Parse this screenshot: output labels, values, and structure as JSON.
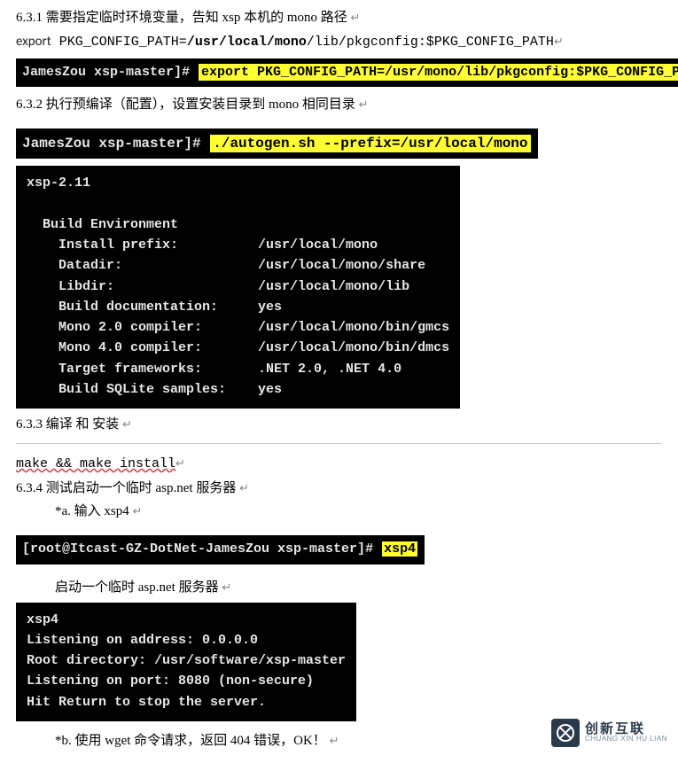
{
  "s1": {
    "num": "6.3.1",
    "text": "需要指定临时环境变量，告知 xsp  本机的  mono 路径",
    "ret": "↵"
  },
  "exportline": {
    "kw": "export",
    "pre": " PKG_CONFIG_PATH=",
    "bold": "/usr/local/mono",
    "post": "/lib/pkgconfig:$PKG_CONFIG_PATH",
    "ret": "↵"
  },
  "cmd1": {
    "prompt": "JamesZou xsp-master]# ",
    "hl": "export PKG_CONFIG_PATH=/usr/mono/lib/pkgconfig:$PKG_CONFIG_PATH"
  },
  "s2": {
    "num": "6.3.2",
    "text": "执行预编译（配置），设置安装目录到  mono 相同目录",
    "ret": "↵"
  },
  "cmd2": {
    "prompt": " JamesZou xsp-master]# ",
    "hl": "./autogen.sh --prefix=/usr/local/mono"
  },
  "buildenv": "xsp-2.11\n\n  Build Environment\n    Install prefix:          /usr/local/mono\n    Datadir:                 /usr/local/mono/share\n    Libdir:                  /usr/local/mono/lib\n    Build documentation:     yes\n    Mono 2.0 compiler:       /usr/local/mono/bin/gmcs\n    Mono 4.0 compiler:       /usr/local/mono/bin/dmcs\n    Target frameworks:       .NET 2.0, .NET 4.0\n    Build SQLite samples:    yes",
  "s3": {
    "num": "6.3.3",
    "text": "编译 和 安装",
    "ret": "↵"
  },
  "make": {
    "text": "make && make install",
    "ret": "↵"
  },
  "s4": {
    "num": "6.3.4",
    "text": "测试启动一个临时 asp.net 服务器",
    "ret": "↵"
  },
  "stepa": {
    "text": "*a. 输入  xsp4",
    "ret": "↵"
  },
  "cmd3": {
    "prompt": "[root@Itcast-GZ-DotNet-JamesZou xsp-master]# ",
    "hl": "xsp4"
  },
  "startline": {
    "text": "启动一个临时 asp.net 服务器",
    "ret": "↵"
  },
  "xspout": "xsp4\nListening on address: 0.0.0.0\nRoot directory: /usr/software/xsp-master\nListening on port: 8080 (non-secure)\nHit Return to stop the server.",
  "stepb": {
    "text": "*b. 使用 wget 命令请求，返回  404 错误，OK！",
    "ret": "↵"
  },
  "logo": {
    "cn": "创新互联",
    "en": "CHUANG XIN HU LIAN"
  }
}
